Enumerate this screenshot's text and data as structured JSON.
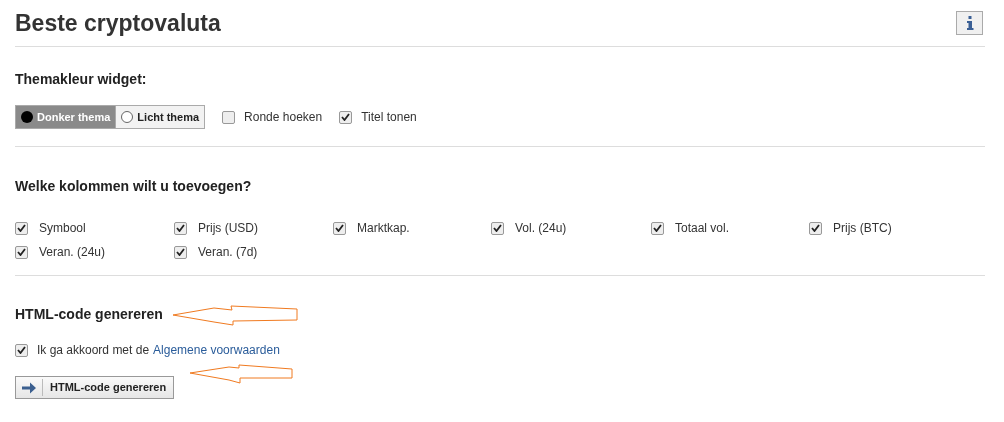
{
  "title": "Beste cryptovaluta",
  "theme_section": {
    "heading": "Themakleur widget:",
    "themes": [
      {
        "label": "Donker thema",
        "selected": true
      },
      {
        "label": "Licht thema",
        "selected": false
      }
    ],
    "options": [
      {
        "label": "Ronde hoeken",
        "checked": false
      },
      {
        "label": "Titel tonen",
        "checked": true
      }
    ]
  },
  "columns_section": {
    "heading": "Welke kolommen wilt u toevoegen?",
    "items": [
      {
        "label": "Symbool",
        "checked": true
      },
      {
        "label": "Prijs (USD)",
        "checked": true
      },
      {
        "label": "Marktkap.",
        "checked": true
      },
      {
        "label": "Vol. (24u)",
        "checked": true
      },
      {
        "label": "Totaal vol.",
        "checked": true
      },
      {
        "label": "Prijs (BTC)",
        "checked": true
      },
      {
        "label": "Veran. (24u)",
        "checked": true
      },
      {
        "label": "Veran. (7d)",
        "checked": true
      }
    ]
  },
  "generate_section": {
    "heading": "HTML-code genereren",
    "agreement": {
      "text": "Ik ga akkoord met de",
      "link": "Algemene voorwaarden",
      "checked": true
    },
    "button": "HTML-code genereren"
  }
}
